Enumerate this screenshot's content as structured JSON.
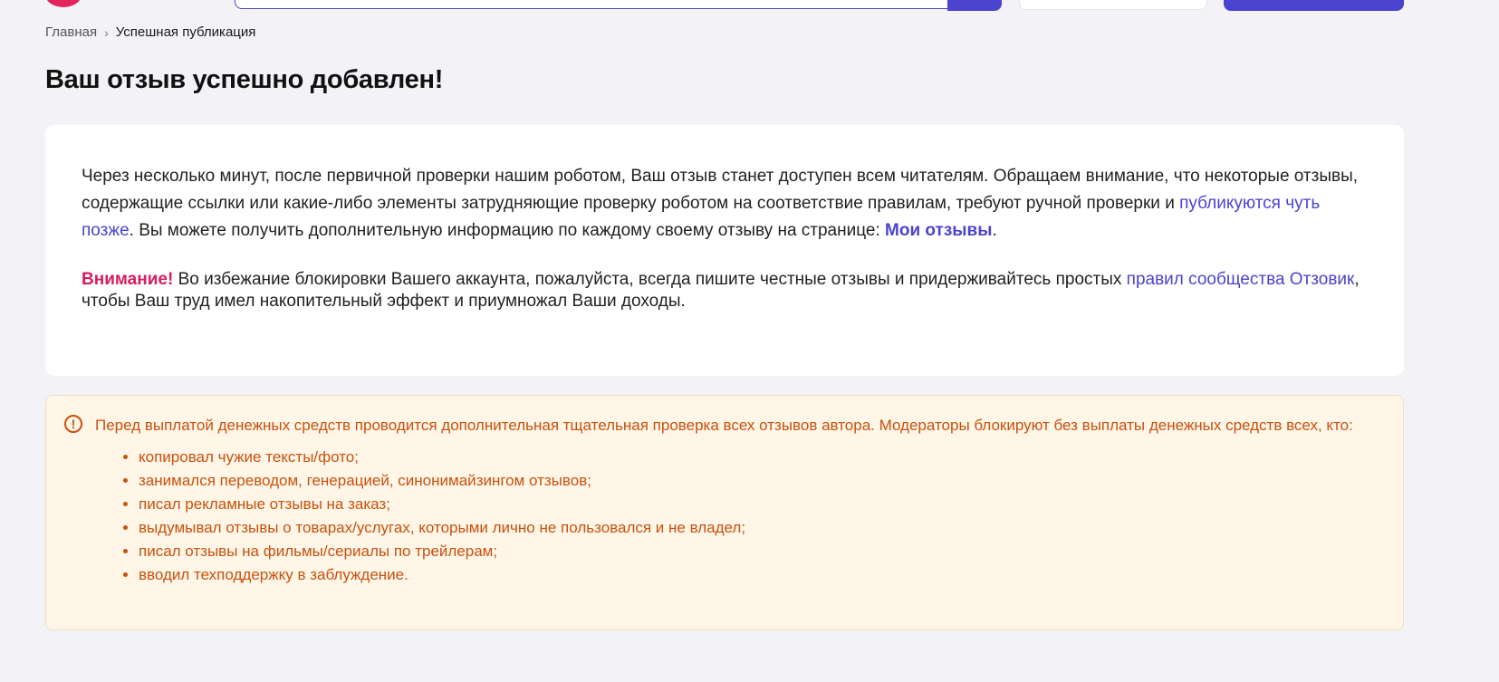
{
  "breadcrumb": {
    "home": "Главная",
    "separator": "›",
    "current": "Успешная публикация"
  },
  "page": {
    "title": "Ваш отзыв успешно добавлен!"
  },
  "info": {
    "part1": "Через несколько минут, после первичной проверки нашим роботом, Ваш отзыв станет доступен всем читателям. Обращаем внимание, что некоторые отзывы, содержащие ссылки или какие-либо элементы затрудняющие проверку роботом на соответствие правилам, требуют ручной проверки и ",
    "link_later": "публикуются чуть позже",
    "part2": ". Вы можете получить дополнительную информацию по каждому своему отзыву на странице: ",
    "link_my_reviews": "Мои отзывы",
    "part3": "."
  },
  "warning": {
    "label": "Внимание!",
    "text1": " Во избежание блокировки Вашего аккаунта, пожалуйста, всегда пишите честные отзывы и придерживайтесь простых ",
    "link_rules": "правил сообщества Отзовик",
    "text2": ", чтобы Ваш труд имел накопительный эффект и приумножал Ваши доходы."
  },
  "alert": {
    "icon": "exclamation-circle-icon",
    "text": "Перед выплатой денежных средств проводится дополнительная тщательная проверка всех отзывов автора. Модераторы блокируют без выплаты денежных средств всех, кто:",
    "items": [
      "копировал чужие тексты/фото;",
      "занимался переводом, генерацией, синонимайзингом отзывов;",
      "писал рекламные отзывы на заказ;",
      "выдумывал отзывы о товарах/услугах, которыми лично не пользовался и не владел;",
      "писал отзывы на фильмы/сериалы по трейлерам;",
      "вводил техподдержку в заблуждение."
    ]
  },
  "colors": {
    "accent": "#4b43d0",
    "brand": "#e0245e",
    "attention": "#d81b60",
    "alert_text": "#c8510e",
    "alert_bg": "#fff6e7",
    "page_bg": "#f3f3f7"
  }
}
